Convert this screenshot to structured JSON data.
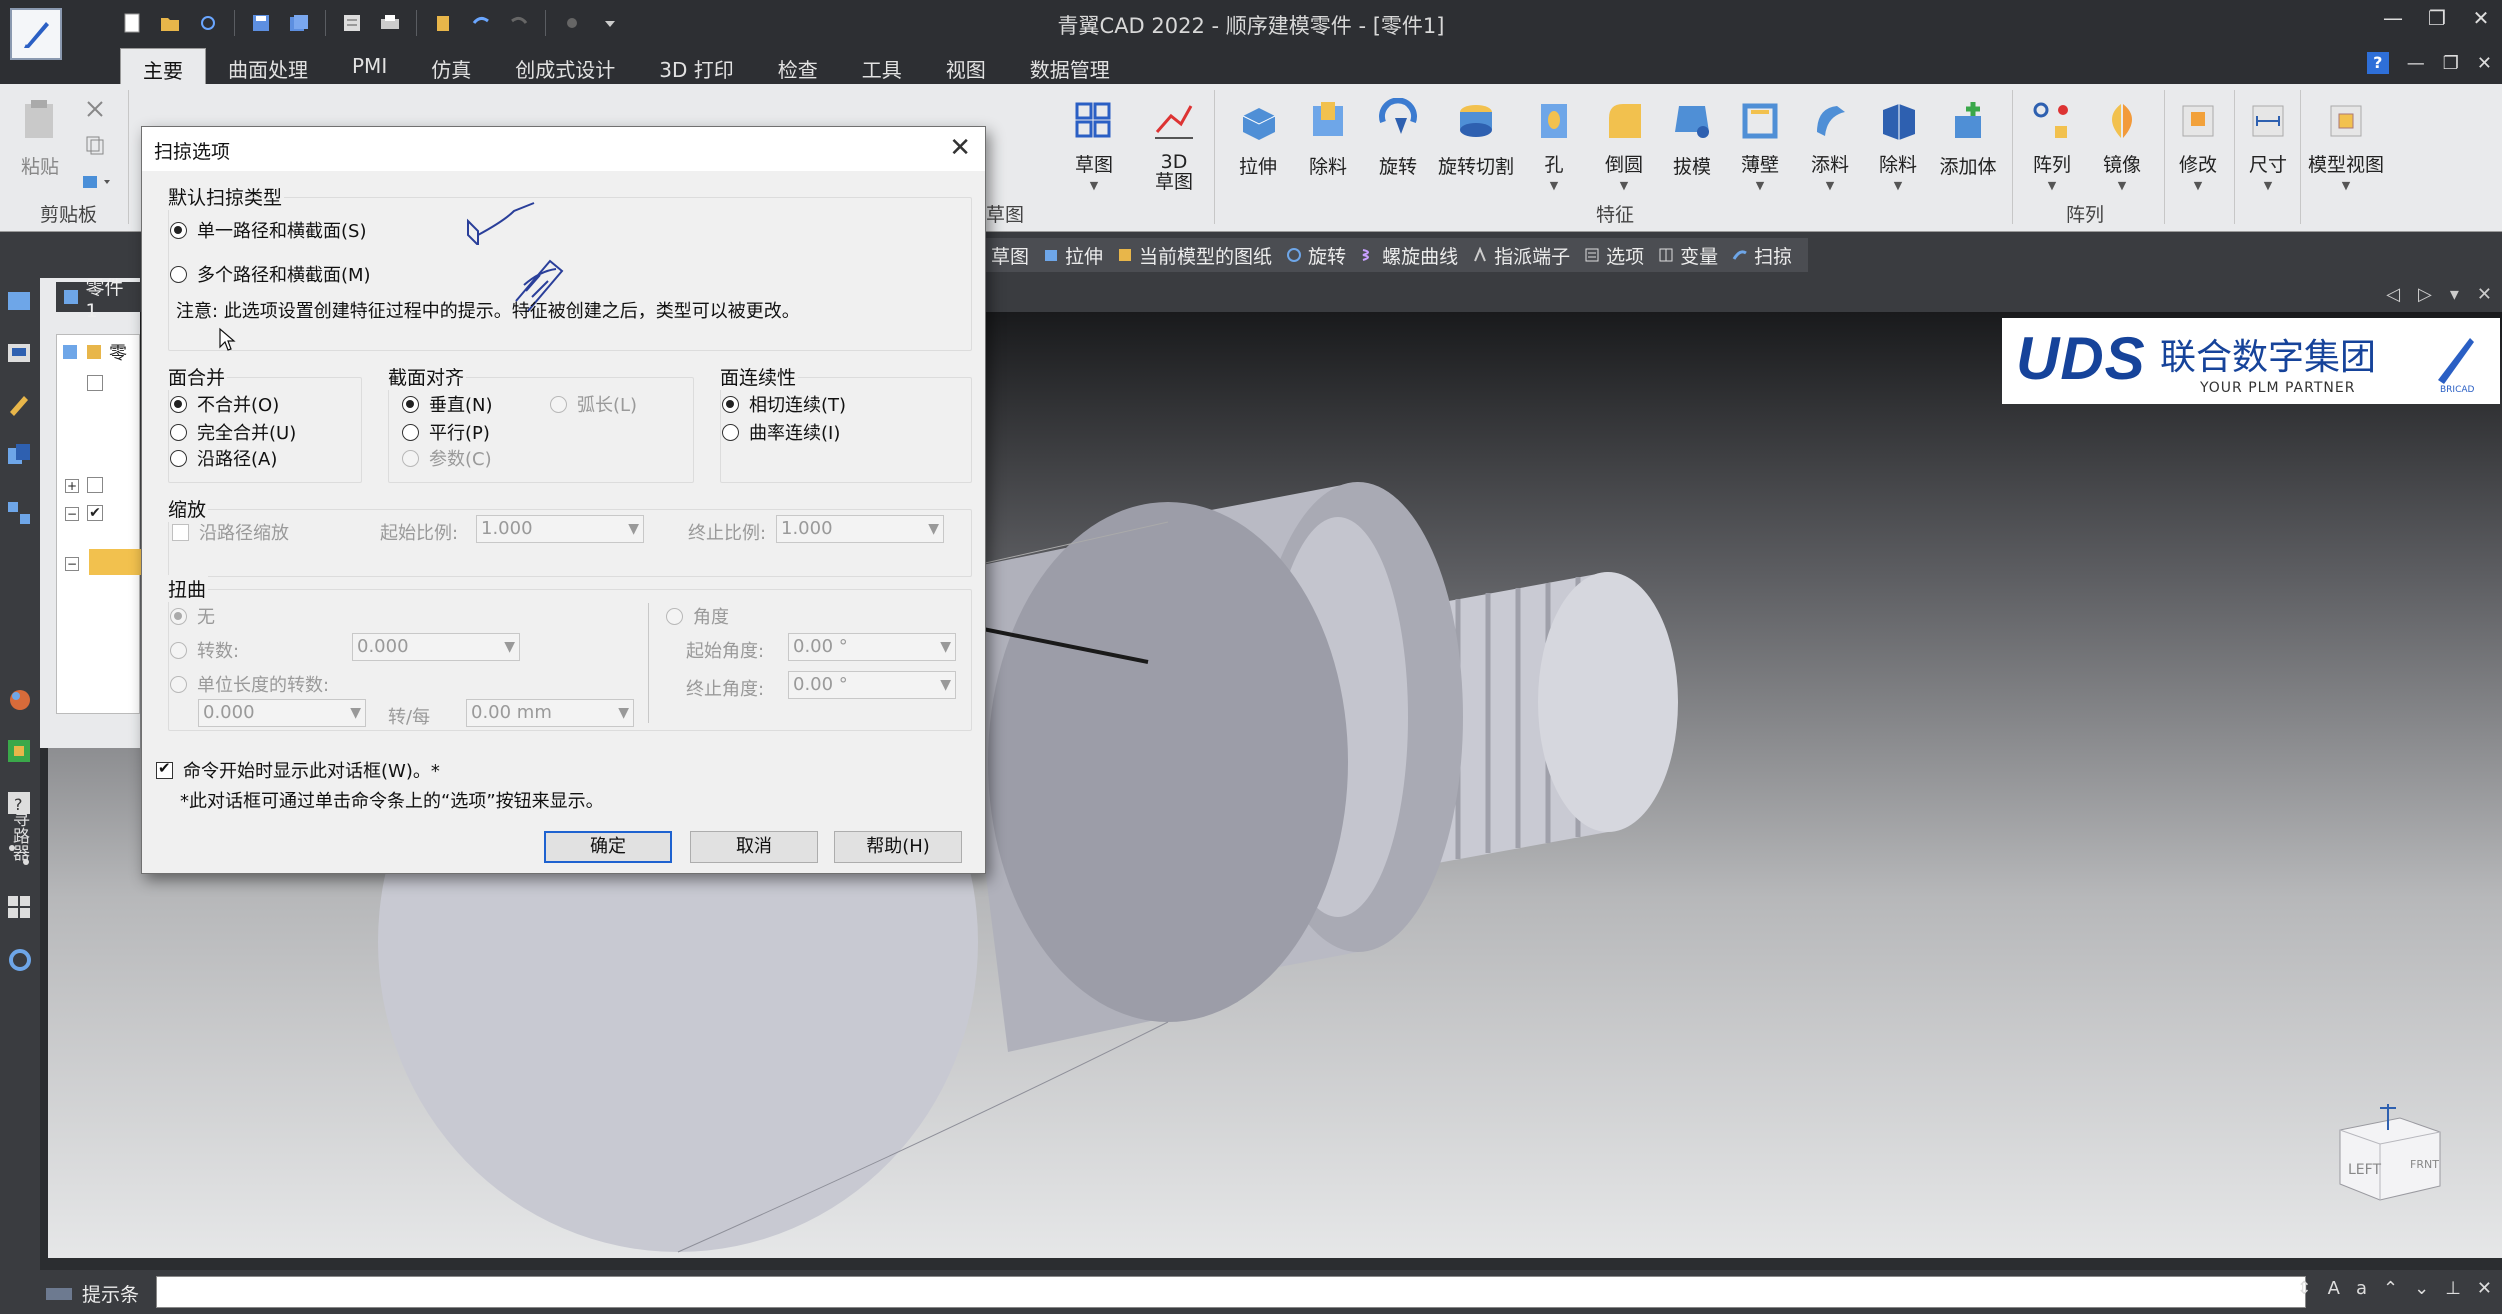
{
  "window": {
    "title": "青翼CAD 2022 - 顺序建模零件 - [零件1]"
  },
  "tabs": [
    "主要",
    "曲面处理",
    "PMI",
    "仿真",
    "创成式设计",
    "3D 打印",
    "检查",
    "工具",
    "视图",
    "数据管理"
  ],
  "ribbon": {
    "clipboard": {
      "paste": "粘贴",
      "group": "剪贴板"
    },
    "sketch": {
      "sketch": "草图",
      "sketch3d": "3D\n草图",
      "group": "草图"
    },
    "features": [
      "拉伸",
      "除料",
      "旋转",
      "旋转切割",
      "孔",
      "倒圆",
      "拔模",
      "薄壁",
      "添料",
      "除料",
      "添加体"
    ],
    "features_group": "特征",
    "pattern": [
      "阵列",
      "镜像"
    ],
    "pattern_group": "阵列",
    "modify": "修改",
    "dimension": "尺寸",
    "model_view": "模型视图"
  },
  "command_bar": [
    "草图",
    "拉伸",
    "当前模型的图纸",
    "旋转",
    "螺旋曲线",
    "指派端子",
    "选项",
    "变量",
    "扫掠"
  ],
  "pathfinder": {
    "tab": "零件1",
    "root": "零",
    "left_label": "寻路器"
  },
  "logo": {
    "main": "UDS",
    "cn": "联合数字集团",
    "en": "YOUR PLM PARTNER",
    "mark": "BRICAD"
  },
  "viewcube": {
    "left": "LEFT",
    "front": "FRNT"
  },
  "prompt": {
    "label": "提示条"
  },
  "dialog": {
    "title": "扫掠选项",
    "sweep_type": {
      "title": "默认扫掠类型",
      "single": "单一路径和横截面(S)",
      "multiple": "多个路径和横截面(M)",
      "note": "注意: 此选项设置创建特征过程中的提示。特征被创建之后，类型可以被更改。"
    },
    "face_merge": {
      "title": "面合并",
      "none": "不合并(O)",
      "full": "完全合并(U)",
      "along_path": "沿路径(A)"
    },
    "section_align": {
      "title": "截面对齐",
      "normal": "垂直(N)",
      "arc": "弧长(L)",
      "parallel": "平行(P)",
      "param": "参数(C)"
    },
    "face_continuity": {
      "title": "面连续性",
      "tangent": "相切连续(T)",
      "curvature": "曲率连续(I)"
    },
    "scale": {
      "title": "缩放",
      "along_path": "沿路径缩放",
      "start_label": "起始比例:",
      "start_value": "1.000",
      "end_label": "终止比例:",
      "end_value": "1.000"
    },
    "twist": {
      "title": "扭曲",
      "none": "无",
      "turns": "转数:",
      "turns_value": "0.000",
      "per_length": "单位长度的转数:",
      "per_length_value": "0.000",
      "per": "转/每",
      "per_value": "0.00 mm",
      "angle": "角度",
      "start_angle_label": "起始角度:",
      "start_angle_value": "0.00 °",
      "end_angle_label": "终止角度:",
      "end_angle_value": "0.00 °"
    },
    "show_dialog": "命令开始时显示此对话框(W)。*",
    "footnote": "*此对话框可通过单击命令条上的“选项”按钮来显示。",
    "buttons": {
      "ok": "确定",
      "cancel": "取消",
      "help": "帮助(H)"
    }
  },
  "colors": {
    "ribbon_bg": "#e9eaec",
    "chrome_dark": "#2d2f33",
    "accent_blue": "#1e62d0",
    "logo_blue": "#16439a"
  }
}
